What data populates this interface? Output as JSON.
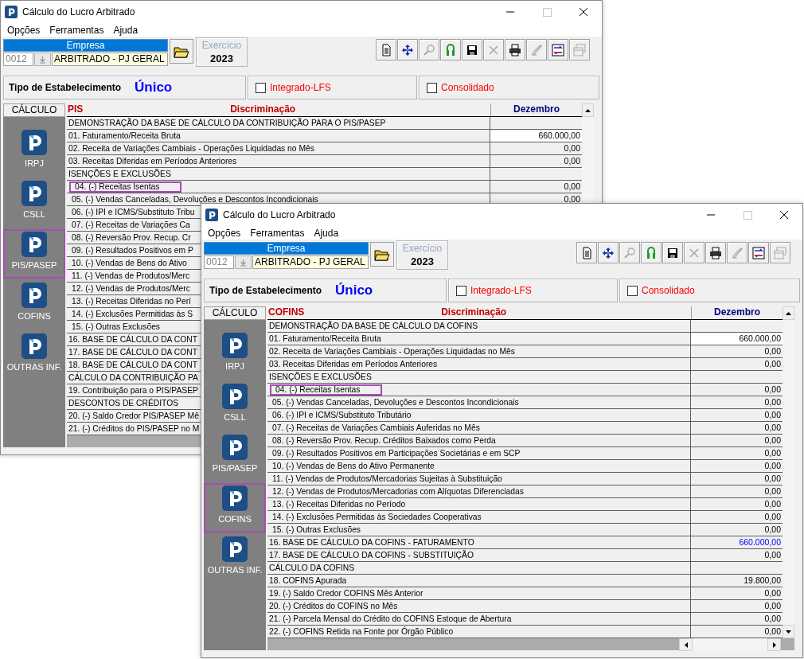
{
  "windows": [
    {
      "title": "Cálculo do Lucro Arbitrado",
      "menu": [
        "Opções",
        "Ferramentas",
        "Ajuda"
      ],
      "company": {
        "label": "Empresa",
        "code": "0012",
        "name": "ARBITRADO - PJ GERAL"
      },
      "fiscal_year": {
        "label": "Exercício",
        "value": "2023"
      },
      "toolbar": [
        {
          "kind": "document",
          "disabled": false
        },
        {
          "kind": "navigate",
          "disabled": false
        },
        {
          "kind": "search",
          "disabled": true
        },
        {
          "kind": "lock",
          "disabled": false
        },
        {
          "kind": "save",
          "disabled": false
        },
        {
          "kind": "delete",
          "disabled": true
        },
        {
          "kind": "print",
          "disabled": false
        },
        {
          "kind": "sign",
          "disabled": true
        },
        {
          "kind": "exchange",
          "disabled": false
        },
        {
          "kind": "windows",
          "disabled": true
        }
      ],
      "establishment": {
        "label": "Tipo de Estabelecimento",
        "value": "Único"
      },
      "options": [
        {
          "label": "Integrado-LFS",
          "checked": false
        },
        {
          "label": "Consolidado",
          "checked": false
        }
      ],
      "sidebar": {
        "title": "CÁLCULO",
        "items": [
          {
            "label": "IRPJ",
            "selected": false
          },
          {
            "label": "CSLL",
            "selected": false
          },
          {
            "label": "PIS/PASEP",
            "selected": true
          },
          {
            "label": "COFINS",
            "selected": false
          },
          {
            "label": "OUTRAS INF.",
            "selected": false
          }
        ]
      },
      "grid": {
        "code": "PIS",
        "columns": [
          "Discriminação",
          "Dezembro"
        ],
        "rows": [
          {
            "kind": "section",
            "text": "DEMONSTRAÇÃO DA BASE DE CÁLCULO DA CONTRIBUIÇÃO PARA O PIS/PASEP",
            "highlighted": false
          },
          {
            "kind": "input",
            "text": "01. Faturamento/Receita Bruta",
            "value": "660.000,00",
            "highlighted": false
          },
          {
            "kind": "item",
            "text": "02. Receita de Variações Cambiais - Operações Liquidadas no Mês",
            "value": "0,00",
            "highlighted": false
          },
          {
            "kind": "item",
            "text": "03. Receitas Diferidas em Períodos Anteriores",
            "value": "0,00",
            "highlighted": false
          },
          {
            "kind": "section",
            "text": "ISENÇÕES E EXCLUSÕES",
            "highlighted": false
          },
          {
            "kind": "sub",
            "text": "04. (-) Receitas Isentas",
            "value": "0,00",
            "highlighted": true
          },
          {
            "kind": "sub",
            "text": "05. (-) Vendas Canceladas, Devoluções e Descontos Incondicionais",
            "value": "0,00",
            "highlighted": false
          },
          {
            "kind": "sub",
            "text": "06. (-) IPI e ICMS/Substituto Tribu",
            "highlighted": false
          },
          {
            "kind": "sub",
            "text": "07. (-) Receitas de Variações Ca",
            "highlighted": false
          },
          {
            "kind": "sub",
            "text": "08. (-) Reversão Prov. Recup. Cr",
            "highlighted": false
          },
          {
            "kind": "sub",
            "text": "09. (-) Resultados Positivos em P",
            "highlighted": false
          },
          {
            "kind": "sub",
            "text": "10. (-) Vendas de Bens do Ativo",
            "highlighted": false
          },
          {
            "kind": "sub",
            "text": "11. (-) Vendas de Produtos/Merc",
            "highlighted": false
          },
          {
            "kind": "sub",
            "text": "12. (-) Vendas de Produtos/Merc",
            "highlighted": false
          },
          {
            "kind": "sub",
            "text": "13. (-) Receitas Diferidas no Perí",
            "highlighted": false
          },
          {
            "kind": "sub",
            "text": "14. (-) Exclusões Permitidas às S",
            "highlighted": false
          },
          {
            "kind": "sub",
            "text": "15. (-) Outras Exclusões",
            "highlighted": false
          },
          {
            "kind": "item",
            "text": "16. BASE DE CÁLCULO DA CONT",
            "highlighted": false
          },
          {
            "kind": "item",
            "text": "17. BASE DE CÁLCULO DA CONT",
            "highlighted": false
          },
          {
            "kind": "item",
            "text": "18. BASE DE CÁLCULO DA CONT",
            "highlighted": false
          },
          {
            "kind": "section",
            "text": "CÁLCULO DA CONTRIBUIÇÃO PA",
            "highlighted": false
          },
          {
            "kind": "item",
            "text": "19. Contribuição para o PIS/PASEP",
            "highlighted": false
          },
          {
            "kind": "section",
            "text": "DESCONTOS DE CRÉDITOS",
            "highlighted": false
          },
          {
            "kind": "item",
            "text": "20. (-) Saldo Credor PIS/PASEP Mê",
            "highlighted": false
          },
          {
            "kind": "item",
            "text": "21. (-) Créditos do PIS/PASEP no M",
            "highlighted": false
          }
        ]
      }
    },
    {
      "title": "Cálculo do Lucro Arbitrado",
      "menu": [
        "Opções",
        "Ferramentas",
        "Ajuda"
      ],
      "company": {
        "label": "Empresa",
        "code": "0012",
        "name": "ARBITRADO - PJ GERAL"
      },
      "fiscal_year": {
        "label": "Exercício",
        "value": "2023"
      },
      "toolbar": [
        {
          "kind": "document",
          "disabled": false
        },
        {
          "kind": "navigate",
          "disabled": false
        },
        {
          "kind": "search",
          "disabled": true
        },
        {
          "kind": "lock",
          "disabled": false
        },
        {
          "kind": "save",
          "disabled": false
        },
        {
          "kind": "delete",
          "disabled": true
        },
        {
          "kind": "print",
          "disabled": false
        },
        {
          "kind": "sign",
          "disabled": true
        },
        {
          "kind": "exchange",
          "disabled": false
        },
        {
          "kind": "windows",
          "disabled": true
        }
      ],
      "establishment": {
        "label": "Tipo de Estabelecimento",
        "value": "Único"
      },
      "options": [
        {
          "label": "Integrado-LFS",
          "checked": false
        },
        {
          "label": "Consolidado",
          "checked": false
        }
      ],
      "sidebar": {
        "title": "CÁLCULO",
        "items": [
          {
            "label": "IRPJ",
            "selected": false
          },
          {
            "label": "CSLL",
            "selected": false
          },
          {
            "label": "PIS/PASEP",
            "selected": false
          },
          {
            "label": "COFINS",
            "selected": true
          },
          {
            "label": "OUTRAS INF.",
            "selected": false
          }
        ]
      },
      "grid": {
        "code": "COFINS",
        "columns": [
          "Discriminação",
          "Dezembro"
        ],
        "rows": [
          {
            "kind": "section",
            "text": "DEMONSTRAÇÃO DA BASE DE CÁLCULO DA COFINS",
            "highlighted": false
          },
          {
            "kind": "input",
            "text": "01. Faturamento/Receita Bruta",
            "value": "660.000,00",
            "highlighted": false
          },
          {
            "kind": "item",
            "text": "02. Receita de Variações Cambiais - Operações Liquidadas no Mês",
            "value": "0,00",
            "highlighted": false
          },
          {
            "kind": "item",
            "text": "03. Receitas Diferidas em Períodos Anteriores",
            "value": "0,00",
            "highlighted": false
          },
          {
            "kind": "section",
            "text": "ISENÇÕES E EXCLUSÕES",
            "highlighted": false
          },
          {
            "kind": "sub",
            "text": "04. (-) Receitas Isentas",
            "value": "0,00",
            "highlighted": true
          },
          {
            "kind": "sub",
            "text": "05. (-) Vendas Canceladas, Devoluções e Descontos Incondicionais",
            "value": "0,00",
            "highlighted": false
          },
          {
            "kind": "sub",
            "text": "06. (-) IPI e ICMS/Substituto Tributário",
            "value": "0,00",
            "highlighted": false
          },
          {
            "kind": "sub",
            "text": "07. (-) Receitas de Variações Cambiais Auferidas no Mês",
            "value": "0,00",
            "highlighted": false
          },
          {
            "kind": "sub",
            "text": "08. (-) Reversão Prov. Recup. Créditos Baixados como Perda",
            "value": "0,00",
            "highlighted": false
          },
          {
            "kind": "sub",
            "text": "09. (-) Resultados Positivos em Participações Societárias e em SCP",
            "value": "0,00",
            "highlighted": false
          },
          {
            "kind": "sub",
            "text": "10. (-) Vendas de Bens do Ativo Permanente",
            "value": "0,00",
            "highlighted": false
          },
          {
            "kind": "sub",
            "text": "11. (-) Vendas de Produtos/Mercadorias Sujeitas à Substituição",
            "value": "0,00",
            "highlighted": false
          },
          {
            "kind": "sub",
            "text": "12. (-) Vendas de Produtos/Mercadorias com Alíquotas Diferenciadas",
            "value": "0,00",
            "highlighted": false
          },
          {
            "kind": "sub",
            "text": "13. (-) Receitas Diferidas no Período",
            "value": "0,00",
            "highlighted": false
          },
          {
            "kind": "sub",
            "text": "14. (-) Exclusões Permitidas às Sociedades Cooperativas",
            "value": "0,00",
            "highlighted": false
          },
          {
            "kind": "sub",
            "text": "15. (-) Outras Exclusões",
            "value": "0,00",
            "highlighted": false
          },
          {
            "kind": "total",
            "text": "16. BASE DE CÁLCULO DA COFINS - FATURAMENTO",
            "value": "660.000,00",
            "highlighted": false
          },
          {
            "kind": "item",
            "text": "17. BASE DE CÁLCULO DA COFINS - SUBSTITUIÇÃO",
            "value": "0,00",
            "highlighted": false
          },
          {
            "kind": "section",
            "text": "CÁLCULO DA COFINS",
            "highlighted": false
          },
          {
            "kind": "item",
            "text": "18. COFINS Apurada",
            "value": "19.800,00",
            "highlighted": false
          },
          {
            "kind": "item",
            "text": "19. (-) Saldo Credor COFINS Mês Anterior",
            "value": "0,00",
            "highlighted": false
          },
          {
            "kind": "item",
            "text": "20. (-) Créditos do COFINS no Mês",
            "value": "0,00",
            "highlighted": false
          },
          {
            "kind": "item",
            "text": "21. (-) Parcela Mensal do Crédito do COFINS Estoque de Abertura",
            "value": "0,00",
            "highlighted": false
          },
          {
            "kind": "item",
            "text": "22. (-) COFINS Retida na Fonte por Órgão Público",
            "value": "0,00",
            "highlighted": false
          }
        ]
      }
    }
  ]
}
